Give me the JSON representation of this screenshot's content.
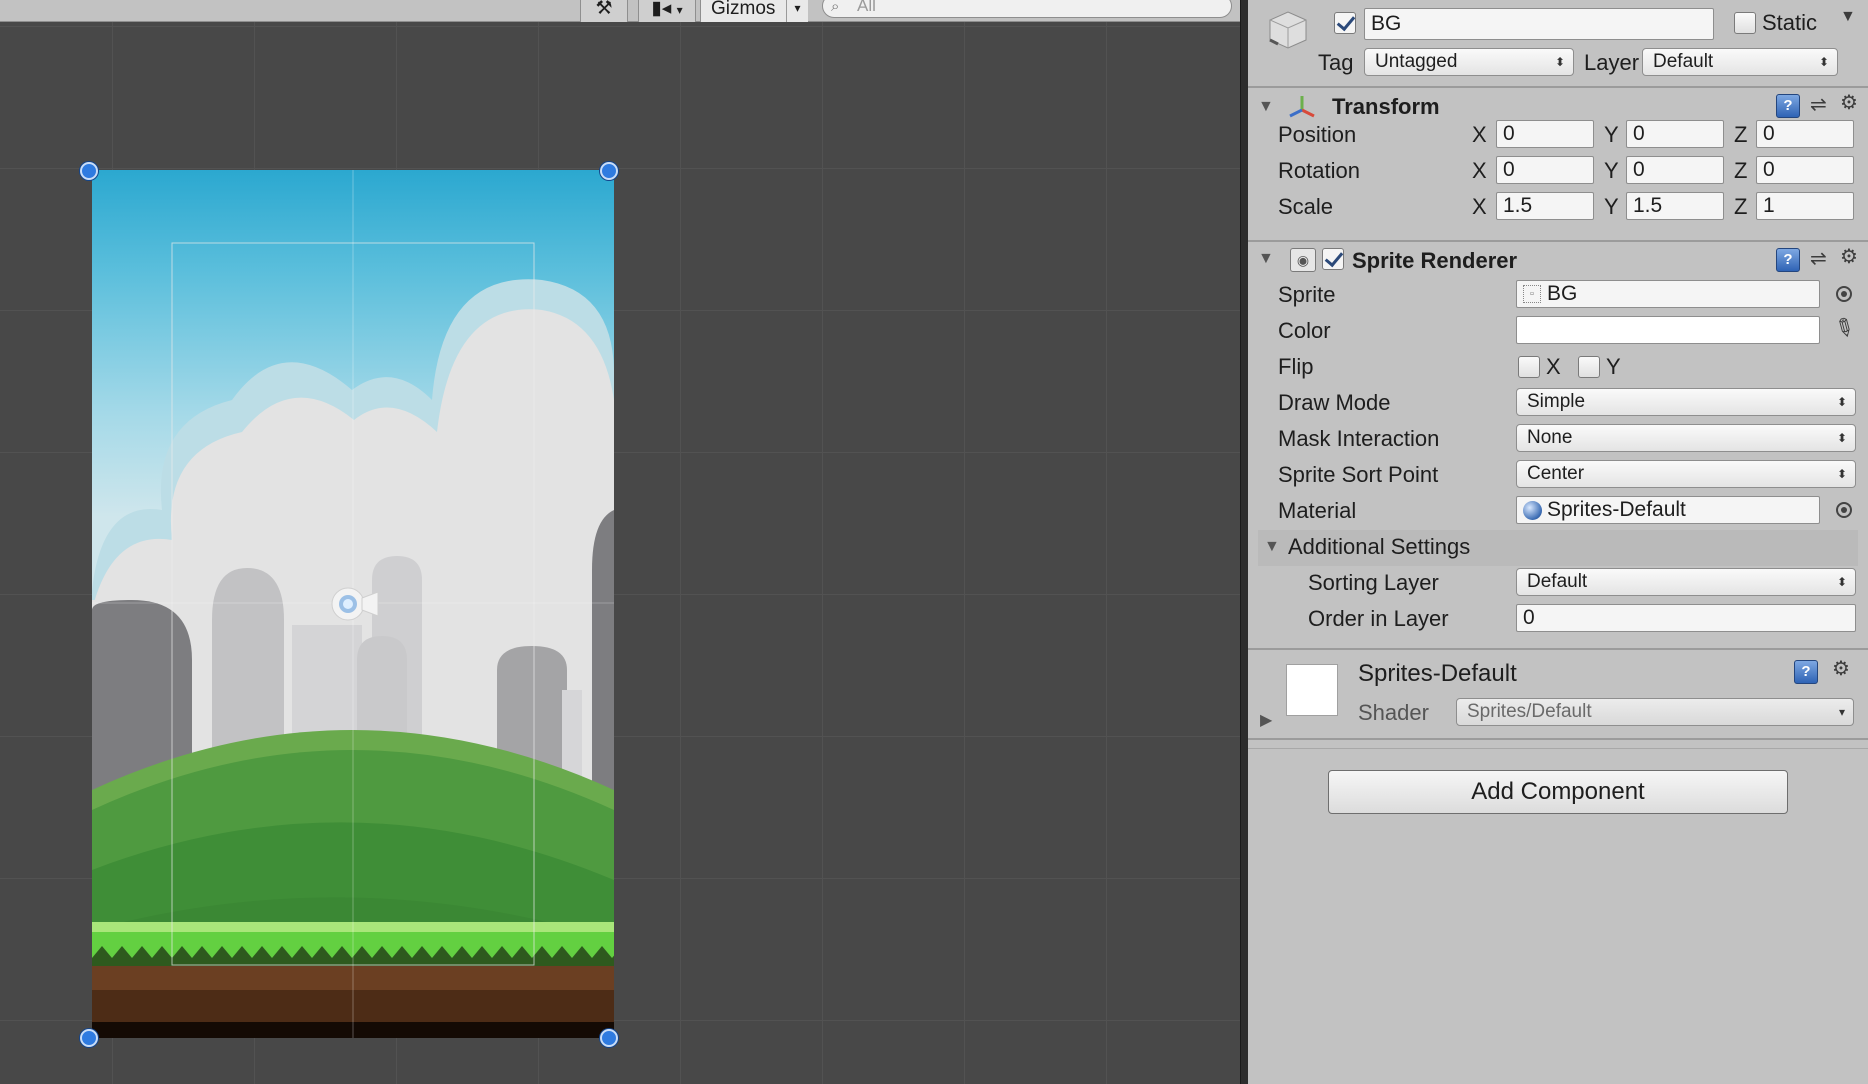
{
  "scene": {
    "gizmos_label": "Gizmos",
    "search_placeholder": "All",
    "tools_icon": "tools-icon",
    "camera_icon": "camera-icon"
  },
  "inspector": {
    "object": {
      "name": "BG",
      "active": true,
      "static_label": "Static",
      "static_checked": false,
      "tag_label": "Tag",
      "tag_value": "Untagged",
      "layer_label": "Layer",
      "layer_value": "Default"
    },
    "transform": {
      "title": "Transform",
      "rows": [
        {
          "label": "Position",
          "x": "0",
          "y": "0",
          "z": "0"
        },
        {
          "label": "Rotation",
          "x": "0",
          "y": "0",
          "z": "0"
        },
        {
          "label": "Scale",
          "x": "1.5",
          "y": "1.5",
          "z": "1"
        }
      ],
      "axis_x": "X",
      "axis_y": "Y",
      "axis_z": "Z"
    },
    "sprite_renderer": {
      "title": "Sprite Renderer",
      "enabled": true,
      "sprite_label": "Sprite",
      "sprite_value": "BG",
      "color_label": "Color",
      "color_value": "#ffffff",
      "flip_label": "Flip",
      "flip_x_label": "X",
      "flip_y_label": "Y",
      "draw_mode_label": "Draw Mode",
      "draw_mode_value": "Simple",
      "mask_label": "Mask Interaction",
      "mask_value": "None",
      "sort_point_label": "Sprite Sort Point",
      "sort_point_value": "Center",
      "material_label": "Material",
      "material_value": "Sprites-Default",
      "additional_label": "Additional Settings",
      "sorting_layer_label": "Sorting Layer",
      "sorting_layer_value": "Default",
      "order_label": "Order in Layer",
      "order_value": "0"
    },
    "material": {
      "name": "Sprites-Default",
      "shader_label": "Shader",
      "shader_value": "Sprites/Default"
    },
    "add_component_label": "Add Component"
  },
  "colors": {
    "inspector_bg": "#c2c2c2",
    "scene_bg": "#484848",
    "handle_blue": "#2f7be0"
  }
}
